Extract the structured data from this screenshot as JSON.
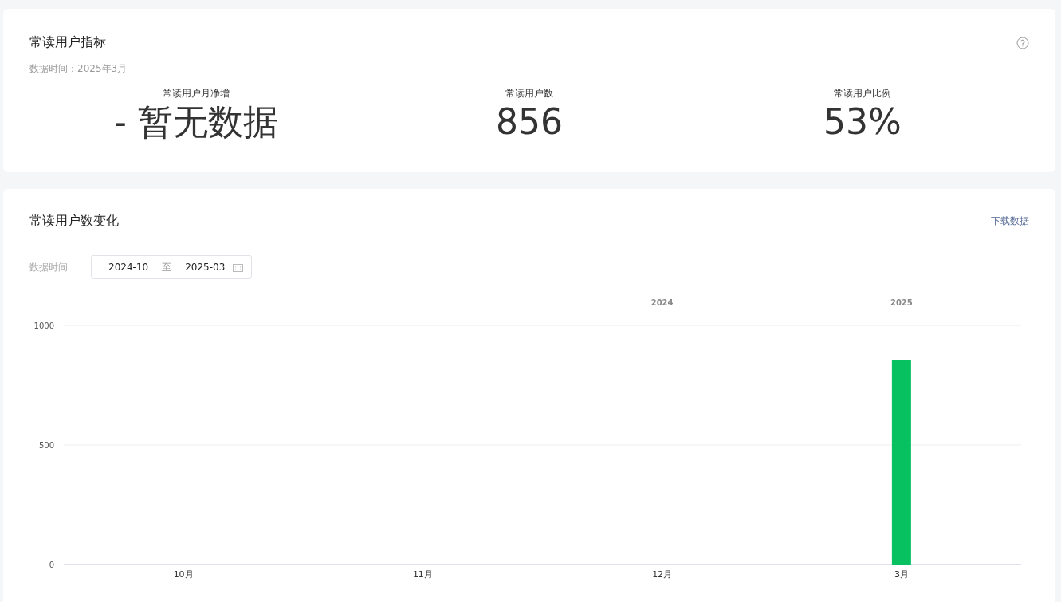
{
  "summary": {
    "title": "常读用户指标",
    "data_time": "数据时间：2025年3月",
    "metrics": [
      {
        "label": "常读用户月净增",
        "value": "- 暂无数据"
      },
      {
        "label": "常读用户数",
        "value": "856"
      },
      {
        "label": "常读用户比例",
        "value": "53%"
      }
    ]
  },
  "trend": {
    "title": "常读用户数变化",
    "download_link": "下载数据",
    "date_label": "数据时间",
    "date_start": "2024-10",
    "date_separator": "至",
    "date_end": "2025-03",
    "chart_data": {
      "type": "bar",
      "categories": [
        "10月",
        "11月",
        "12月",
        "3月"
      ],
      "series": [
        {
          "color": "#07c160",
          "values": [
            null,
            null,
            null,
            856
          ]
        }
      ],
      "ylim": [
        0,
        1000
      ],
      "yticks": [
        0,
        500,
        1000
      ],
      "annotations": [
        "2024",
        "2025"
      ]
    }
  }
}
